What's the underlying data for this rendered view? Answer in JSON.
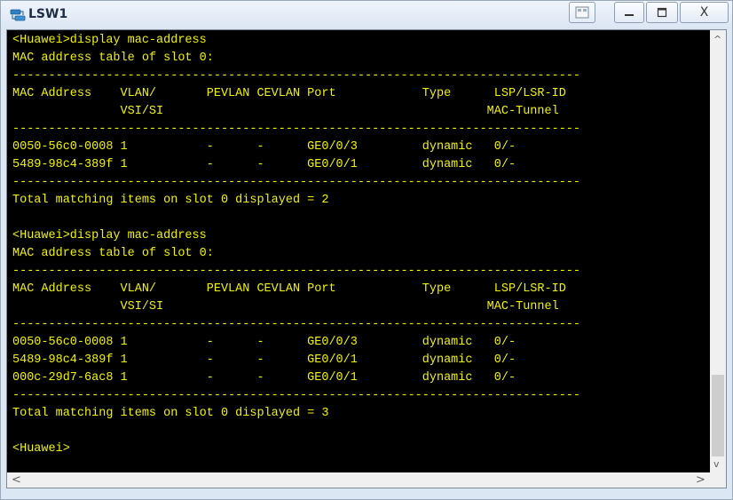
{
  "window": {
    "title": "LSW1",
    "buttons": {
      "minimize": "_",
      "maximize": "□",
      "close": "X"
    }
  },
  "terminal": {
    "lines": [
      "<Huawei>display mac-address",
      "MAC address table of slot 0:",
      "-------------------------------------------------------------------------------",
      "MAC Address    VLAN/       PEVLAN CEVLAN Port            Type      LSP/LSR-ID",
      "               VSI/SI                                             MAC-Tunnel",
      "-------------------------------------------------------------------------------",
      "0050-56c0-0008 1           -      -      GE0/0/3         dynamic   0/-",
      "5489-98c4-389f 1           -      -      GE0/0/1         dynamic   0/-",
      "-------------------------------------------------------------------------------",
      "Total matching items on slot 0 displayed = 2",
      "",
      "<Huawei>display mac-address",
      "MAC address table of slot 0:",
      "-------------------------------------------------------------------------------",
      "MAC Address    VLAN/       PEVLAN CEVLAN Port            Type      LSP/LSR-ID",
      "               VSI/SI                                             MAC-Tunnel",
      "-------------------------------------------------------------------------------",
      "0050-56c0-0008 1           -      -      GE0/0/3         dynamic   0/-",
      "5489-98c4-389f 1           -      -      GE0/0/1         dynamic   0/-",
      "000c-29d7-6ac8 1           -      -      GE0/0/1         dynamic   0/-",
      "-------------------------------------------------------------------------------",
      "Total matching items on slot 0 displayed = 3",
      "",
      "<Huawei>"
    ]
  },
  "colors": {
    "terminal_bg": "#000000",
    "terminal_fg": "#f2f200",
    "titlebar": "#dbe6f3"
  },
  "icons": {
    "app": "network-switch-icon",
    "aux": "panel-icon",
    "scroll_up": "chevron-up-icon",
    "scroll_down": "chevron-down-icon",
    "scroll_left": "chevron-left-icon",
    "scroll_right": "chevron-right-icon"
  }
}
